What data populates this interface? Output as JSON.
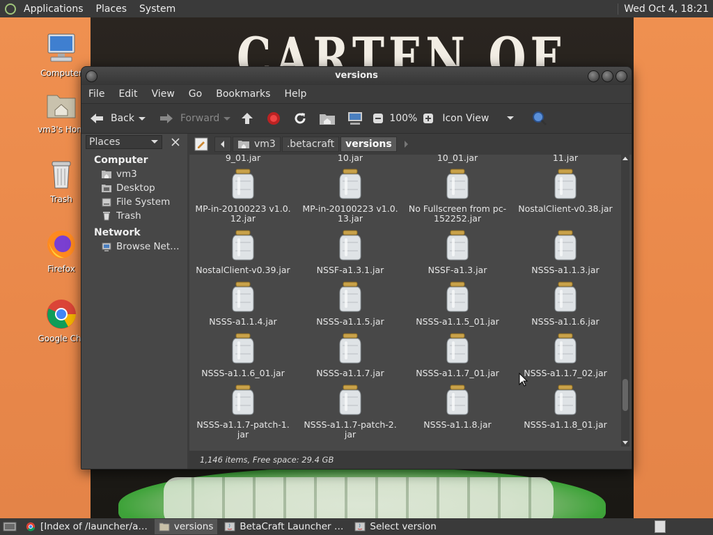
{
  "top_panel": {
    "menus": [
      "Applications",
      "Places",
      "System"
    ],
    "clock": "Wed Oct  4, 18:21"
  },
  "desktop": {
    "background_title": "CARTEN OF",
    "icons": [
      {
        "label": "Computer",
        "icon": "computer-icon"
      },
      {
        "label": "vm3's Hom",
        "icon": "home-folder-icon"
      },
      {
        "label": "Trash",
        "icon": "trash-icon"
      },
      {
        "label": "Firefox",
        "icon": "firefox-icon"
      },
      {
        "label": "Google Chr",
        "icon": "chrome-icon"
      }
    ]
  },
  "window": {
    "title": "versions",
    "menu": [
      "File",
      "Edit",
      "View",
      "Go",
      "Bookmarks",
      "Help"
    ],
    "toolbar": {
      "back": "Back",
      "forward": "Forward",
      "zoom": "100%",
      "view_mode": "Icon View"
    },
    "sidebar": {
      "selector": "Places",
      "sections": [
        {
          "title": "Computer",
          "items": [
            {
              "label": "vm3",
              "icon": "home-folder-icon"
            },
            {
              "label": "Desktop",
              "icon": "desktop-icon"
            },
            {
              "label": "File System",
              "icon": "drive-icon"
            },
            {
              "label": "Trash",
              "icon": "trash-icon"
            }
          ]
        },
        {
          "title": "Network",
          "items": [
            {
              "label": "Browse Net…",
              "icon": "network-icon"
            }
          ]
        }
      ]
    },
    "path": [
      "vm3",
      ".betacraft",
      "versions"
    ],
    "files_partial_top": [
      "9_01.jar",
      "10.jar",
      "10_01.jar",
      "11.jar"
    ],
    "files": [
      [
        "MP-in-20100223 v1.0.",
        "12.jar"
      ],
      [
        "MP-in-20100223 v1.0.",
        "13.jar"
      ],
      [
        "No Fullscreen from pc-",
        "152252.jar"
      ],
      [
        "NostalClient-v0.38.jar"
      ],
      [
        "NostalClient-v0.39.jar"
      ],
      [
        "NSSF-a1.3.1.jar"
      ],
      [
        "NSSF-a1.3.jar"
      ],
      [
        "NSSS-a1.1.3.jar"
      ],
      [
        "NSSS-a1.1.4.jar"
      ],
      [
        "NSSS-a1.1.5.jar"
      ],
      [
        "NSSS-a1.1.5_01.jar"
      ],
      [
        "NSSS-a1.1.6.jar"
      ],
      [
        "NSSS-a1.1.6_01.jar"
      ],
      [
        "NSSS-a1.1.7.jar"
      ],
      [
        "NSSS-a1.1.7_01.jar"
      ],
      [
        "NSSS-a1.1.7_02.jar"
      ],
      [
        "NSSS-a1.1.7-patch-1.",
        "jar"
      ],
      [
        "NSSS-a1.1.7-patch-2.",
        "jar"
      ],
      [
        "NSSS-a1.1.8.jar"
      ],
      [
        "NSSS-a1.1.8_01.jar"
      ]
    ],
    "status": "1,146 items, Free space: 29.4 GB"
  },
  "taskbar": {
    "tasks": [
      {
        "label": "[Index of /launcher/a…",
        "icon": "chrome-icon",
        "active": false
      },
      {
        "label": "versions",
        "icon": "folder-icon",
        "active": true
      },
      {
        "label": "BetaCraft Launcher …",
        "icon": "java-icon",
        "active": false
      },
      {
        "label": "Select version",
        "icon": "java-icon",
        "active": false
      }
    ]
  }
}
